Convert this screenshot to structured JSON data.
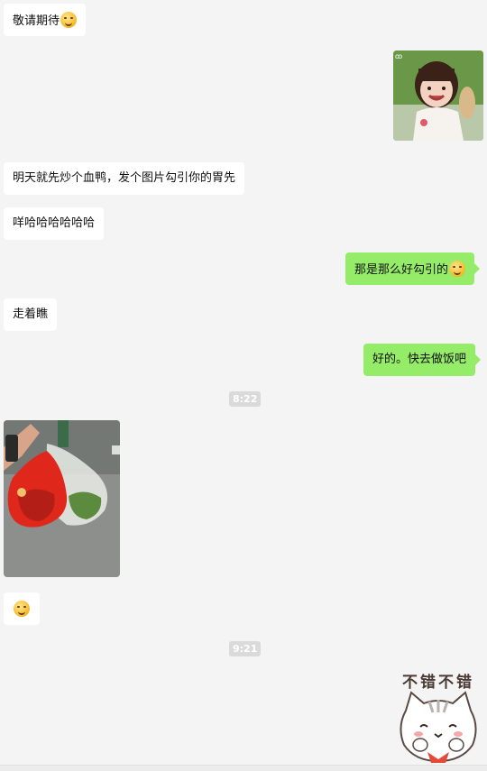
{
  "messages": {
    "m1": "敬请期待",
    "m3": "明天就先炒个血鸭，发个图片勾引你的胃先",
    "m4": "咩哈哈哈哈哈哈",
    "m5": "那是那么好勾引的",
    "m6": "走着瞧",
    "m7": "好的。快去做饭吧"
  },
  "timestamps": {
    "t1": "8:22",
    "t2": "9:21"
  },
  "sticker": {
    "caption": "不错不错"
  },
  "colors": {
    "background": "#f4f4f4",
    "left_bubble": "#ffffff",
    "right_bubble": "#95ec69",
    "timestamp_bg": "#dadada"
  }
}
